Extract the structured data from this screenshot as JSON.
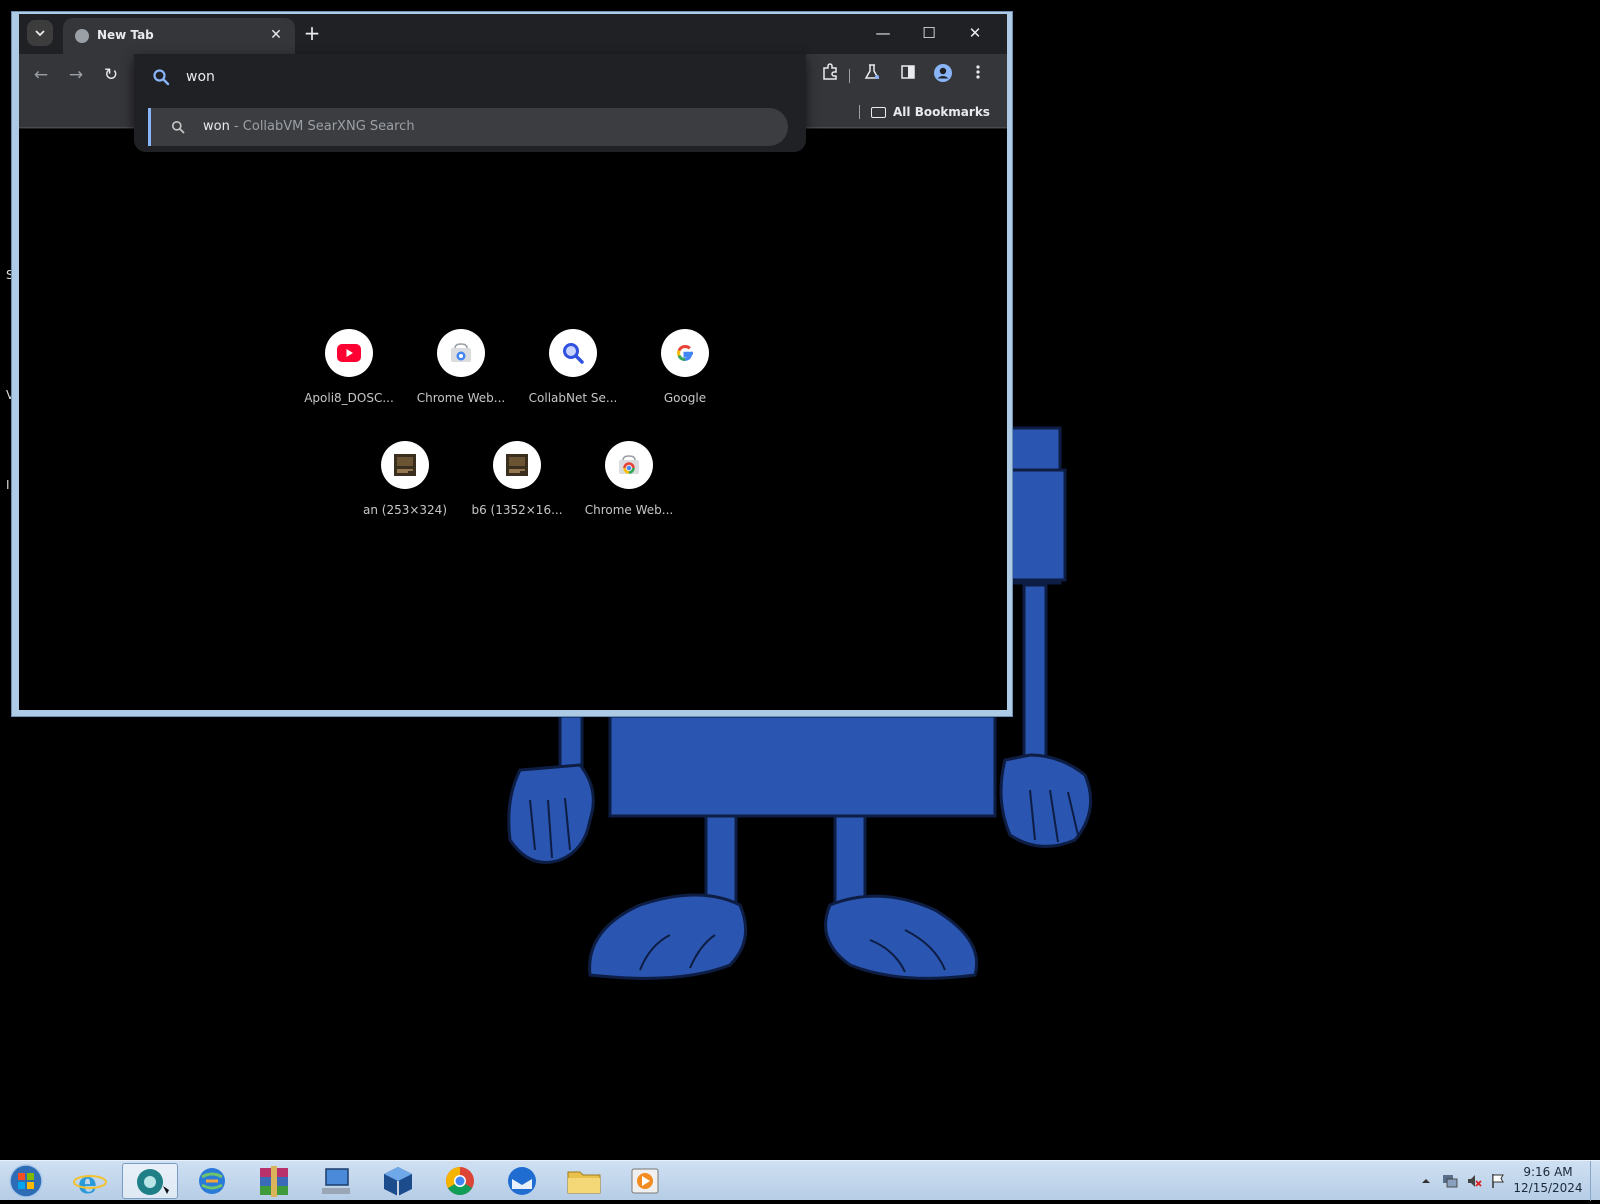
{
  "desktop": {
    "slivers": [
      "S",
      "V",
      "I"
    ]
  },
  "browser": {
    "tab": {
      "title": "New Tab",
      "close": "✕"
    },
    "new_tab": "+",
    "window_controls": {
      "minimize": "—",
      "maximize": "☐",
      "close": "✕"
    },
    "toolbar": {
      "back": "←",
      "forward": "→",
      "reload": "↻"
    },
    "bookmarks": {
      "all_label": "All Bookmarks"
    },
    "omnibox": {
      "value": "won",
      "suggestion_query": "won",
      "suggestion_desc": " - CollabVM SearXNG Search"
    },
    "shortcuts": [
      {
        "label": "Apoli8_DOSC...",
        "icon": "youtube-icon"
      },
      {
        "label": "Chrome Web...",
        "icon": "chrome-web-store-icon"
      },
      {
        "label": "CollabNet Se...",
        "icon": "magnifier-icon"
      },
      {
        "label": "Google",
        "icon": "google-icon"
      },
      {
        "label": "an (253×324)",
        "icon": "image-thumb-icon"
      },
      {
        "label": "b6 (1352×16...",
        "icon": "image-thumb-icon"
      },
      {
        "label": "Chrome Web...",
        "icon": "chrome-web-store-icon"
      }
    ]
  },
  "taskbar": {
    "clock_time": "9:16 AM",
    "clock_date": "12/15/2024"
  },
  "colors": {
    "accent": "#8ab4f8",
    "chrome_dark": "#202124",
    "toolbar": "#35363a",
    "wallpaper_blue": "#2a55b0"
  }
}
